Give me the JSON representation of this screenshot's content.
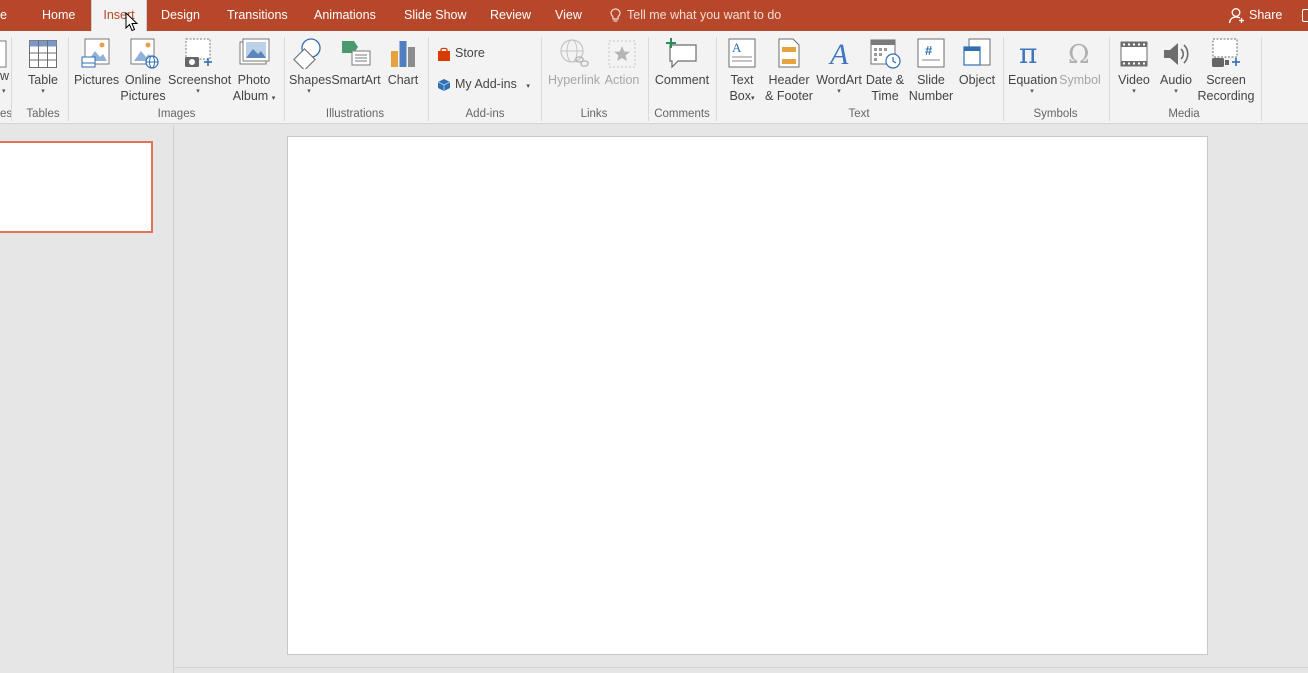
{
  "tabs": [
    {
      "id": "file",
      "label": "e"
    },
    {
      "id": "home",
      "label": "Home"
    },
    {
      "id": "insert",
      "label": "Insert",
      "active": true
    },
    {
      "id": "design",
      "label": "Design"
    },
    {
      "id": "transitions",
      "label": "Transitions"
    },
    {
      "id": "animations",
      "label": "Animations"
    },
    {
      "id": "slideshow",
      "label": "Slide Show"
    },
    {
      "id": "review",
      "label": "Review"
    },
    {
      "id": "view",
      "label": "View"
    }
  ],
  "tell_me": "Tell me what you want to do",
  "share": "Share",
  "ribbon": {
    "partial_left_label": "w",
    "groups": {
      "slides_partial": "es",
      "tables": "Tables",
      "images": "Images",
      "illustrations": "Illustrations",
      "addins": "Add-ins",
      "links": "Links",
      "comments": "Comments",
      "text": "Text",
      "symbols": "Symbols",
      "media": "Media"
    },
    "buttons": {
      "table": "Table",
      "pictures": "Pictures",
      "online_pictures_1": "Online",
      "online_pictures_2": "Pictures",
      "screenshot": "Screenshot",
      "photo_album_1": "Photo",
      "photo_album_2": "Album",
      "shapes": "Shapes",
      "smartart": "SmartArt",
      "chart": "Chart",
      "store": "Store",
      "my_addins": "My Add-ins",
      "hyperlink": "Hyperlink",
      "action": "Action",
      "comment": "Comment",
      "textbox_1": "Text",
      "textbox_2": "Box",
      "header_1": "Header",
      "header_2": "& Footer",
      "wordart": "WordArt",
      "datetime_1": "Date &",
      "datetime_2": "Time",
      "slidenum_1": "Slide",
      "slidenum_2": "Number",
      "object": "Object",
      "equation": "Equation",
      "symbol": "Symbol",
      "video": "Video",
      "audio": "Audio",
      "screenrec_1": "Screen",
      "screenrec_2": "Recording"
    }
  },
  "colors": {
    "accent": "#b7472a",
    "thumb_border": "#e2735a"
  }
}
